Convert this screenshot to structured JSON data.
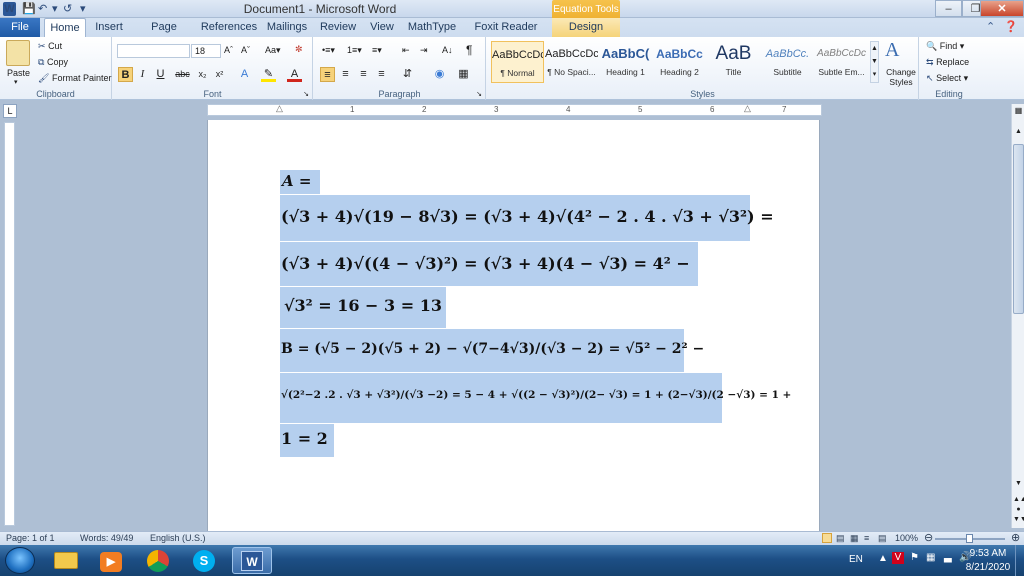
{
  "title_bar": {
    "app_letter": "W",
    "document_title": "Document1 - Microsoft Word",
    "contextual_group": "Equation Tools",
    "qat_icons": [
      "save-icon",
      "undo-icon",
      "redo-icon",
      "customize-qat-icon"
    ]
  },
  "tabs": [
    {
      "label": "File"
    },
    {
      "label": "Home"
    },
    {
      "label": "Insert"
    },
    {
      "label": "Page Layout"
    },
    {
      "label": "References"
    },
    {
      "label": "Mailings"
    },
    {
      "label": "Review"
    },
    {
      "label": "View"
    },
    {
      "label": "MathType"
    },
    {
      "label": "Foxit Reader PDF"
    },
    {
      "label": "Design"
    }
  ],
  "active_tab": "Home",
  "ribbon": {
    "clipboard": {
      "label": "Clipboard",
      "paste": "Paste",
      "cut": "Cut",
      "copy": "Copy",
      "format_painter": "Format Painter"
    },
    "font": {
      "label": "Font",
      "font_name": "",
      "font_size": "18"
    },
    "paragraph": {
      "label": "Paragraph"
    },
    "styles": {
      "label": "Styles",
      "items": [
        {
          "preview": "AaBbCcDc",
          "name": "¶ Normal"
        },
        {
          "preview": "AaBbCcDc",
          "name": "¶ No Spaci..."
        },
        {
          "preview": "AaBbC(",
          "name": "Heading 1"
        },
        {
          "preview": "AaBbCc",
          "name": "Heading 2"
        },
        {
          "preview": "AaB",
          "name": "Title"
        },
        {
          "preview": "AaBbCc.",
          "name": "Subtitle"
        },
        {
          "preview": "AaBbCcDc",
          "name": "Subtle Em..."
        }
      ],
      "change_styles": "Change Styles"
    },
    "editing": {
      "label": "Editing",
      "find": "Find",
      "replace": "Replace",
      "select": "Select"
    }
  },
  "ruler_numbers": [
    "1",
    "2",
    "3",
    "4",
    "5",
    "6",
    "7"
  ],
  "document": {
    "lines": [
      "A =",
      "(√3 + 4)√(19 − 8√3) = (√3 + 4)√(4² − 2 . 4 . √3 + √3²) =",
      "(√3 + 4)√((4 − √3)²) = (√3 + 4)(4 − √3) = 4² −",
      "√3² = 16 − 3 = 13",
      "B = (√5 − 2)(√5 + 2) − √(7−4√3)/(√3 − 2) = √5² − 2² −",
      "√(2²−2 .2 . √3 + √3²)/(√3 −2) = 5 − 4 + √((2 − √3)²)/(2− √3) = 1 + (2−√3)/(2 −√3) = 1 +",
      "1 = 2"
    ]
  },
  "status_bar": {
    "page": "Page: 1 of 1",
    "words": "Words: 49/49",
    "language": "English (U.S.)",
    "zoom": "100%"
  },
  "taskbar": {
    "apps": [
      "windows-explorer-icon",
      "media-player-icon",
      "chrome-icon",
      "skype-icon",
      "word-icon"
    ],
    "lang": "EN",
    "time": "9:53 AM",
    "date": "8/21/2020"
  }
}
